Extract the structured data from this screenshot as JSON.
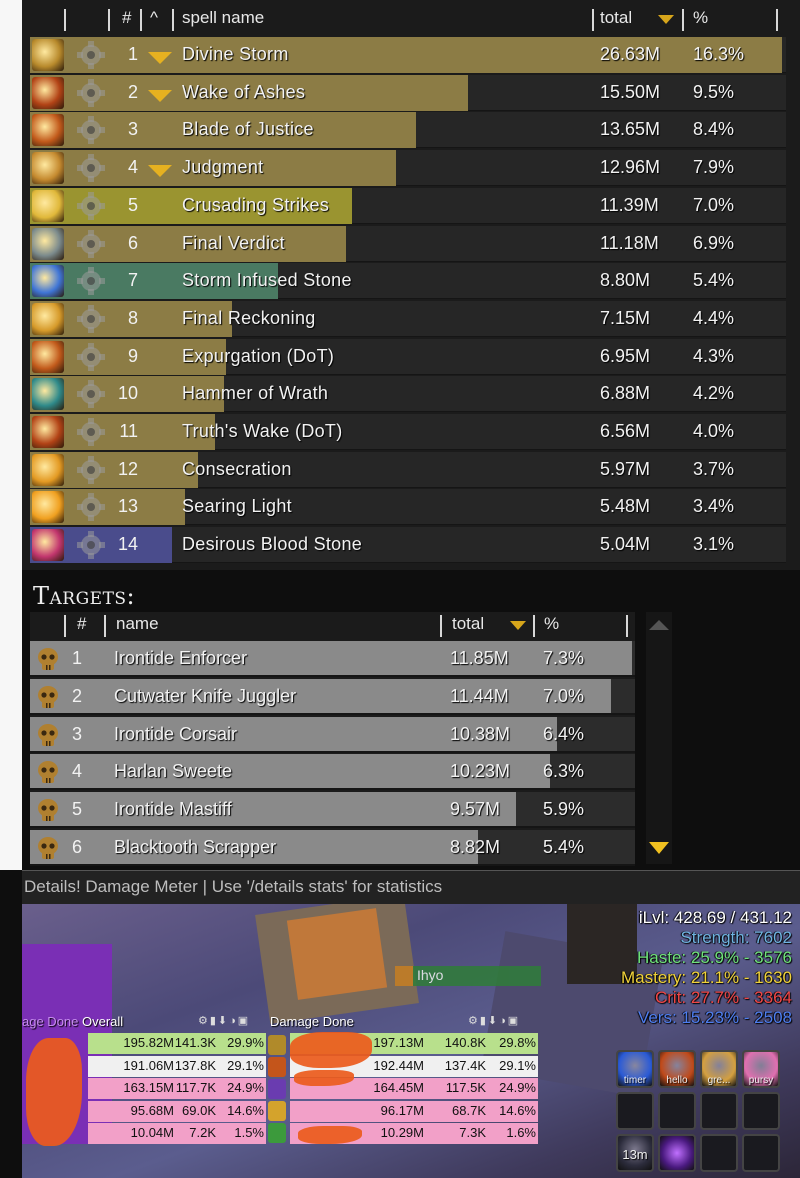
{
  "spells": {
    "header": {
      "index": "#",
      "caret": "^",
      "name": "spell name",
      "total": "total",
      "percent": "%"
    },
    "rows": [
      {
        "index": "1",
        "name": "Divine Storm",
        "total": "26.63M",
        "percent": "16.3%",
        "expanded": true,
        "icon": "divine-storm-icon",
        "bar_fraction": 1.0,
        "bar_color": "#8c7c45",
        "icon_color": "#b88a2c"
      },
      {
        "index": "2",
        "name": "Wake of Ashes",
        "total": "15.50M",
        "percent": "9.5%",
        "expanded": true,
        "icon": "wake-of-ashes-icon",
        "bar_fraction": 0.582,
        "bar_color": "#8c7c45",
        "icon_color": "#b24316"
      },
      {
        "index": "3",
        "name": "Blade of Justice",
        "total": "13.65M",
        "percent": "8.4%",
        "expanded": false,
        "icon": "blade-of-justice-icon",
        "bar_fraction": 0.513,
        "bar_color": "#8c7c45",
        "icon_color": "#c25a1b"
      },
      {
        "index": "4",
        "name": "Judgment",
        "total": "12.96M",
        "percent": "7.9%",
        "expanded": true,
        "icon": "judgment-icon",
        "bar_fraction": 0.487,
        "bar_color": "#8c7c45",
        "icon_color": "#c58a2f"
      },
      {
        "index": "5",
        "name": "Crusading Strikes",
        "total": "11.39M",
        "percent": "7.0%",
        "expanded": false,
        "icon": "crusading-strikes-icon",
        "bar_fraction": 0.428,
        "bar_color": "#9a9430",
        "icon_color": "#e0b83a"
      },
      {
        "index": "6",
        "name": "Final Verdict",
        "total": "11.18M",
        "percent": "6.9%",
        "expanded": false,
        "icon": "final-verdict-icon",
        "bar_fraction": 0.42,
        "bar_color": "#8c7c45",
        "icon_color": "#7b8a8c"
      },
      {
        "index": "7",
        "name": "Storm Infused Stone",
        "total": "8.80M",
        "percent": "5.4%",
        "expanded": false,
        "icon": "storm-infused-stone-icon",
        "bar_fraction": 0.33,
        "bar_color": "#4a7a62",
        "icon_color": "#3f75d6"
      },
      {
        "index": "8",
        "name": "Final Reckoning",
        "total": "7.15M",
        "percent": "4.4%",
        "expanded": false,
        "icon": "final-reckoning-icon",
        "bar_fraction": 0.268,
        "bar_color": "#8c7c45",
        "icon_color": "#d69a2a"
      },
      {
        "index": "9",
        "name": "Expurgation (DoT)",
        "total": "6.95M",
        "percent": "4.3%",
        "expanded": false,
        "icon": "expurgation-icon",
        "bar_fraction": 0.261,
        "bar_color": "#8c7c45",
        "icon_color": "#c25a1b"
      },
      {
        "index": "10",
        "name": "Hammer of Wrath",
        "total": "6.88M",
        "percent": "4.2%",
        "expanded": false,
        "icon": "hammer-of-wrath-icon",
        "bar_fraction": 0.258,
        "bar_color": "#8c7c45",
        "icon_color": "#2f8a8a"
      },
      {
        "index": "11",
        "name": "Truth's Wake (DoT)",
        "total": "6.56M",
        "percent": "4.0%",
        "expanded": false,
        "icon": "truths-wake-icon",
        "bar_fraction": 0.246,
        "bar_color": "#8c7c45",
        "icon_color": "#b24316"
      },
      {
        "index": "12",
        "name": "Consecration",
        "total": "5.97M",
        "percent": "3.7%",
        "expanded": false,
        "icon": "consecration-icon",
        "bar_fraction": 0.224,
        "bar_color": "#8c7c45",
        "icon_color": "#e39a23"
      },
      {
        "index": "13",
        "name": "Searing Light",
        "total": "5.48M",
        "percent": "3.4%",
        "expanded": false,
        "icon": "searing-light-icon",
        "bar_fraction": 0.206,
        "bar_color": "#8c7c45",
        "icon_color": "#f0a020"
      },
      {
        "index": "14",
        "name": "Desirous Blood Stone",
        "total": "5.04M",
        "percent": "3.1%",
        "expanded": false,
        "icon": "desirous-blood-stone-icon",
        "bar_fraction": 0.189,
        "bar_color": "#4a4c8c",
        "icon_color": "#c2366e"
      }
    ]
  },
  "targets": {
    "title": "Targets:",
    "header": {
      "index": "#",
      "name": "name",
      "total": "total",
      "percent": "%"
    },
    "rows": [
      {
        "index": "1",
        "name": "Irontide Enforcer",
        "total": "11.85M",
        "percent": "7.3%",
        "bar_fraction": 1.0
      },
      {
        "index": "2",
        "name": "Cutwater Knife Juggler",
        "total": "11.44M",
        "percent": "7.0%",
        "bar_fraction": 0.965
      },
      {
        "index": "3",
        "name": "Irontide Corsair",
        "total": "10.38M",
        "percent": "6.4%",
        "bar_fraction": 0.876
      },
      {
        "index": "4",
        "name": "Harlan Sweete",
        "total": "10.23M",
        "percent": "6.3%",
        "bar_fraction": 0.863
      },
      {
        "index": "5",
        "name": "Irontide Mastiff",
        "total": "9.57M",
        "percent": "5.9%",
        "bar_fraction": 0.808
      },
      {
        "index": "6",
        "name": "Blacktooth Scrapper",
        "total": "8.82M",
        "percent": "5.4%",
        "bar_fraction": 0.744
      }
    ]
  },
  "footer": {
    "text": "Details! Damage Meter | Use '/details stats' for statistics"
  },
  "game": {
    "player_name": "Ihyo",
    "stats": {
      "ilvl": "iLvl: 428.69 / 431.12",
      "strength": "Strength: 7602",
      "haste": "Haste: 25.9% - 3576",
      "mastery": "Mastery: 21.1% - 1630",
      "crit": "Crit: 27.7% - 3364",
      "vers": "Vers: 15.23% - 2508"
    },
    "meter_left": {
      "title_prefix": "age Done",
      "title_mode": "Overall",
      "rows": [
        {
          "amount": "195.82M",
          "dps": "141.3K",
          "percent": "29.9%",
          "color": "#b8e08c"
        },
        {
          "amount": "191.06M",
          "dps": "137.8K",
          "percent": "29.1%",
          "color": "#f0f0f0"
        },
        {
          "amount": "163.15M",
          "dps": "117.7K",
          "percent": "24.9%",
          "color": "#f2a0c8"
        },
        {
          "amount": "95.68M",
          "dps": "69.0K",
          "percent": "14.6%",
          "color": "#f2a0c8"
        },
        {
          "amount": "10.04M",
          "dps": "7.2K",
          "percent": "1.5%",
          "color": "#f2a0c8"
        }
      ]
    },
    "meter_right": {
      "title": "Damage Done",
      "rows": [
        {
          "amount": "197.13M",
          "dps": "140.8K",
          "percent": "29.8%",
          "color": "#b8e08c"
        },
        {
          "amount": "192.44M",
          "dps": "137.4K",
          "percent": "29.1%",
          "color": "#f0f0f0"
        },
        {
          "amount": "164.45M",
          "dps": "117.5K",
          "percent": "24.9%",
          "color": "#f2a0c8"
        },
        {
          "amount": "96.17M",
          "dps": "68.7K",
          "percent": "14.6%",
          "color": "#f2a0c8"
        },
        {
          "amount": "10.29M",
          "dps": "7.3K",
          "percent": "1.6%",
          "color": "#f2a0c8"
        }
      ]
    },
    "action_buttons": [
      {
        "label": "timer",
        "icon": "timer-icon"
      },
      {
        "label": "hello",
        "icon": "hello-icon"
      },
      {
        "label": "gre...",
        "icon": "greet-icon"
      },
      {
        "label": "pursy",
        "icon": "pursy-icon"
      },
      {
        "label": "13m",
        "icon": "cooldown-icon"
      }
    ]
  }
}
